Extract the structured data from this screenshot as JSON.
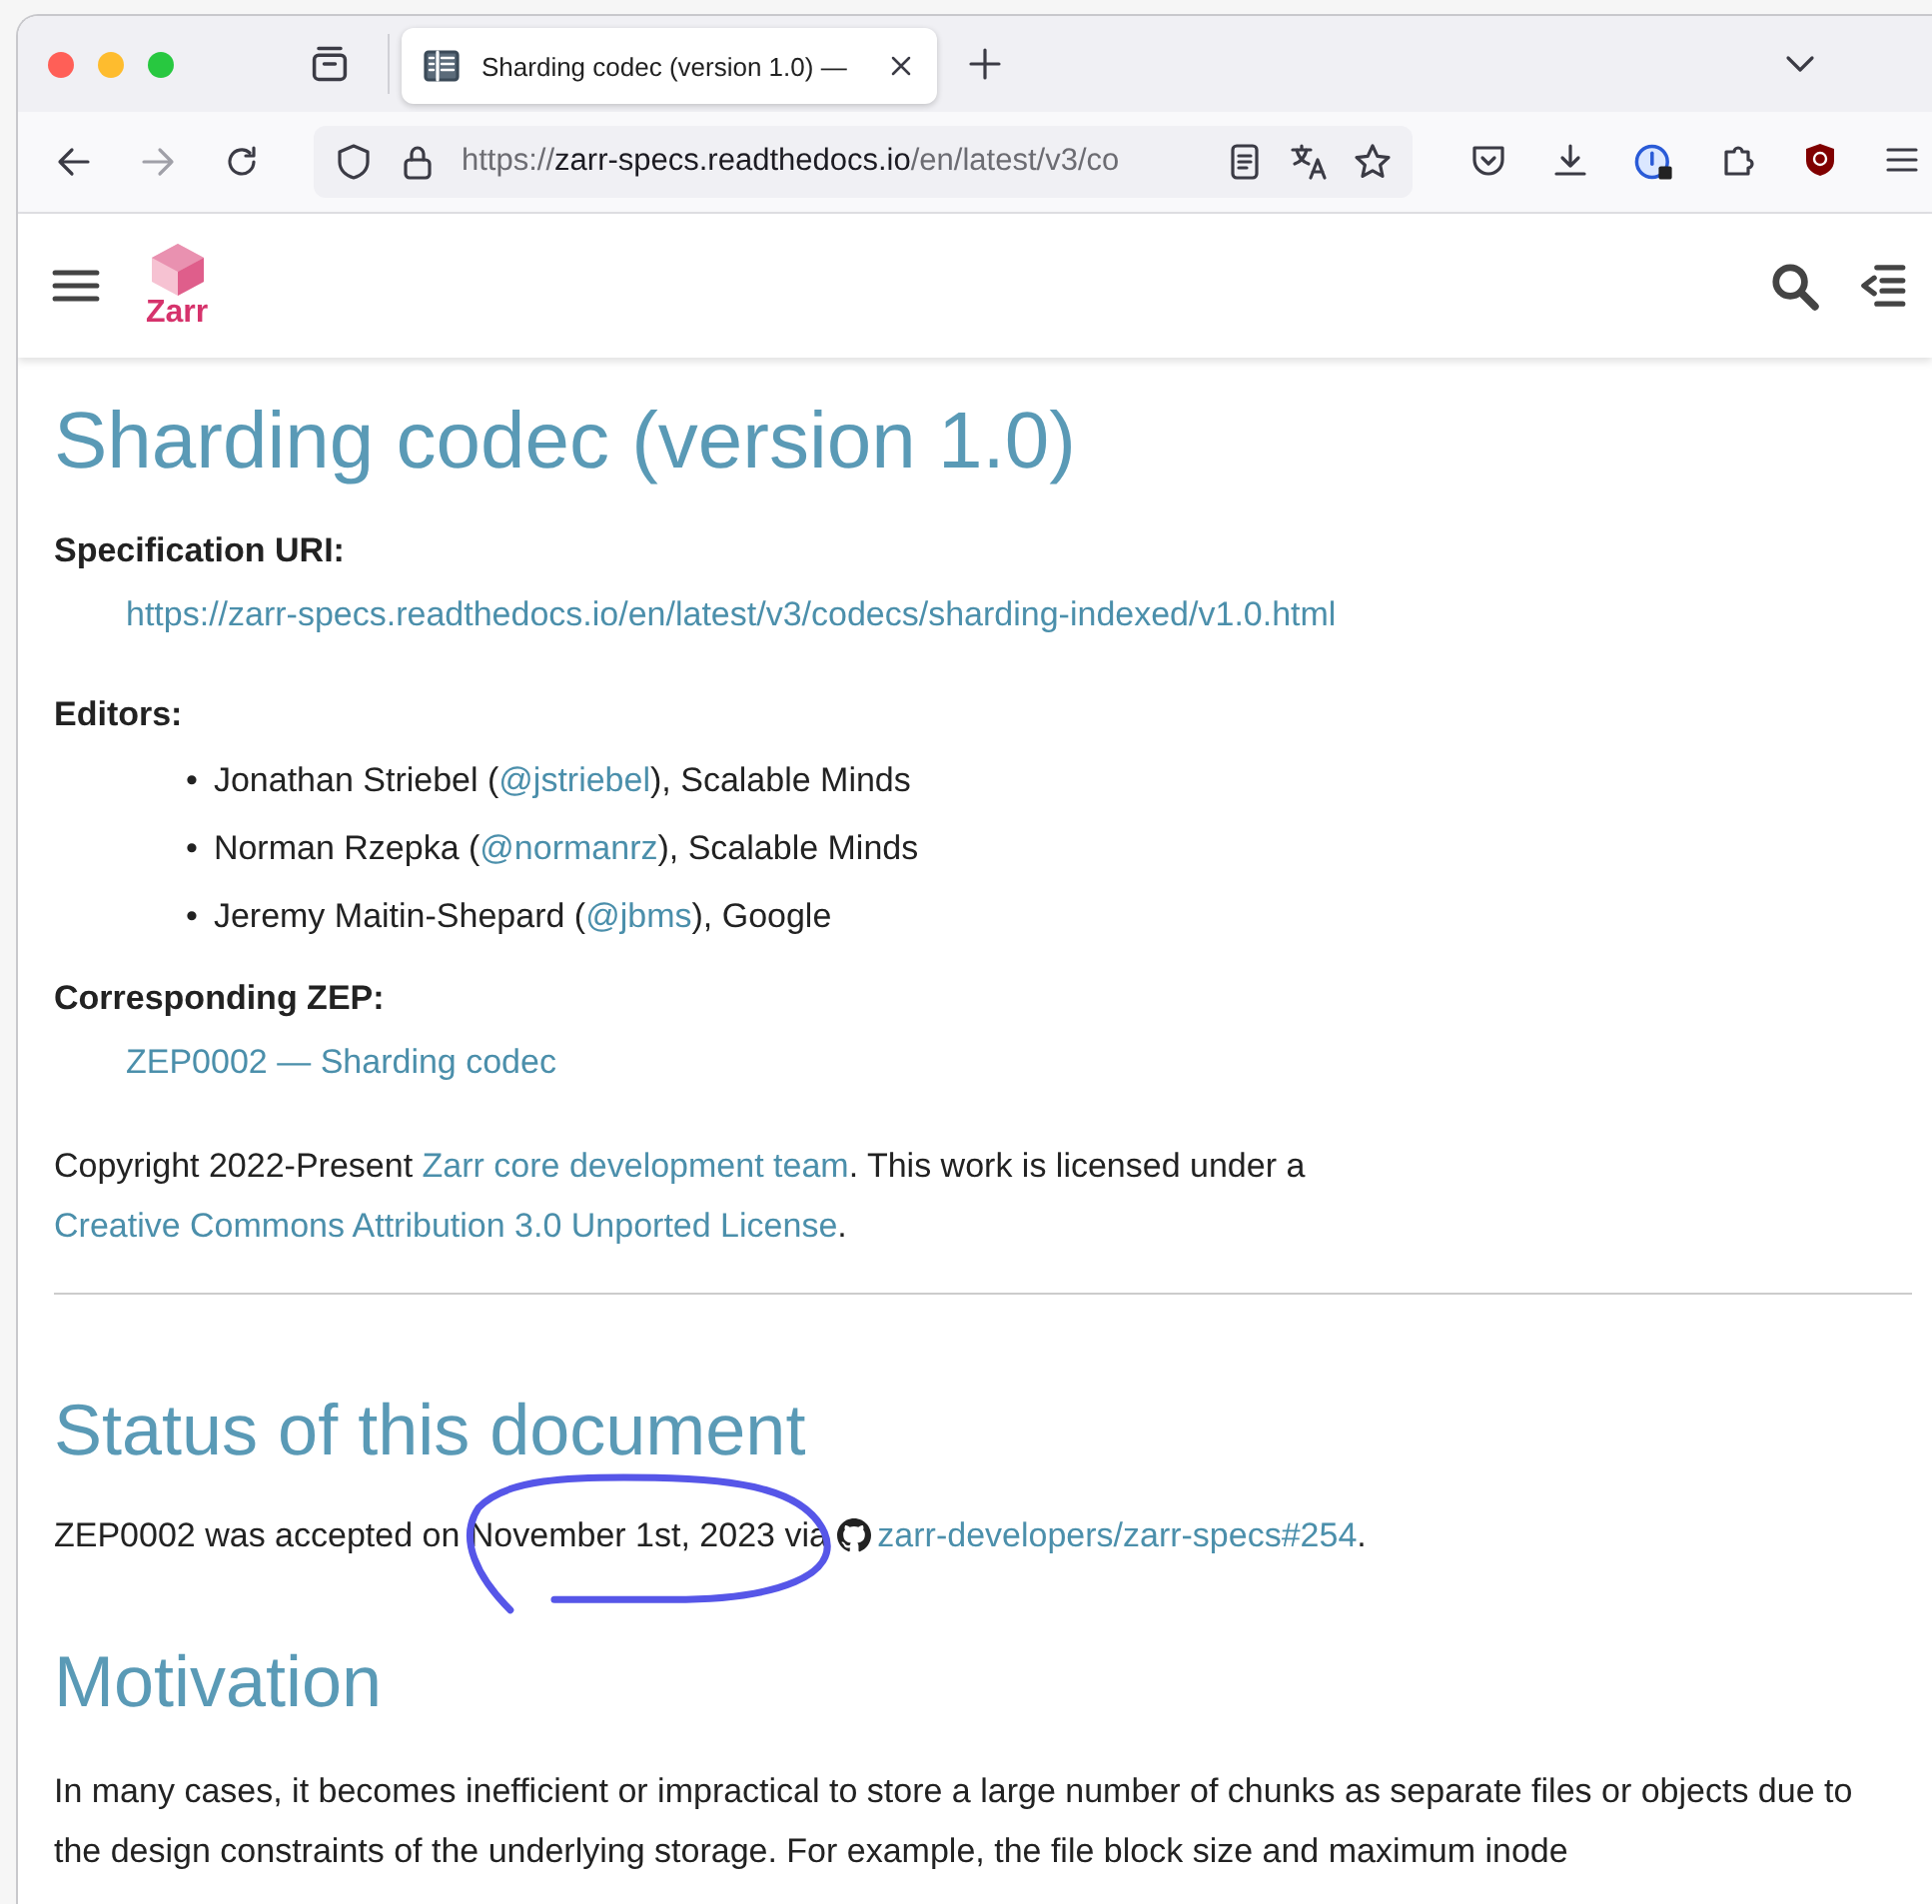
{
  "browser": {
    "tab": {
      "title": "Sharding codec (version 1.0) —",
      "selected": true
    },
    "address": {
      "scheme": "https://",
      "host": "zarr-specs.readthedocs.io",
      "path": "/en/latest/v3/co"
    }
  },
  "site_header": {
    "logo_text": "Zarr"
  },
  "article": {
    "title": "Sharding codec (version 1.0)",
    "fields": [
      {
        "label": "Specification URI:",
        "kind": "link",
        "value": "https://zarr-specs.readthedocs.io/en/latest/v3/codecs/sharding-indexed/v1.0.html"
      },
      {
        "label": "Editors:",
        "kind": "list",
        "items": [
          {
            "marker": "•",
            "segments": [
              {
                "kind": "text",
                "text": "Jonathan Striebel ("
              },
              {
                "kind": "link",
                "text": "@jstriebel"
              },
              {
                "kind": "text",
                "text": "), Scalable Minds"
              }
            ]
          },
          {
            "marker": "•",
            "segments": [
              {
                "kind": "text",
                "text": "Norman Rzepka ("
              },
              {
                "kind": "link",
                "text": "@normanrz"
              },
              {
                "kind": "text",
                "text": "), Scalable Minds"
              }
            ]
          },
          {
            "marker": "•",
            "segments": [
              {
                "kind": "text",
                "text": "Jeremy Maitin-Shepard ("
              },
              {
                "kind": "link",
                "text": "@jbms"
              },
              {
                "kind": "text",
                "text": "), Google"
              }
            ]
          }
        ]
      },
      {
        "label": "Corresponding ZEP:",
        "kind": "link",
        "value": "ZEP0002 — Sharding codec"
      }
    ],
    "copyright": [
      {
        "kind": "text",
        "text": "Copyright 2022-Present "
      },
      {
        "kind": "link",
        "text": "Zarr core development team"
      },
      {
        "kind": "text",
        "text": ". This work is licensed under a "
      },
      {
        "kind": "link",
        "text": "Creative Commons Attribution 3.0 Unported License"
      },
      {
        "kind": "text",
        "text": "."
      }
    ],
    "sections": [
      {
        "heading": "Status of this document",
        "paragraph": [
          {
            "kind": "text",
            "text": "ZEP0002 was accepted on November 1st, 2023 via "
          },
          {
            "kind": "repo_link",
            "text": "zarr-developers/zarr-specs#254"
          },
          {
            "kind": "text",
            "text": "."
          }
        ]
      },
      {
        "heading": "Motivation",
        "paragraph": [
          {
            "kind": "text",
            "text": "In many cases, it becomes inefficient or impractical to store a large number of chunks as separate files or objects due to the design constraints of the underlying storage. For example, the file block size and maximum inode"
          }
        ]
      }
    ]
  }
}
